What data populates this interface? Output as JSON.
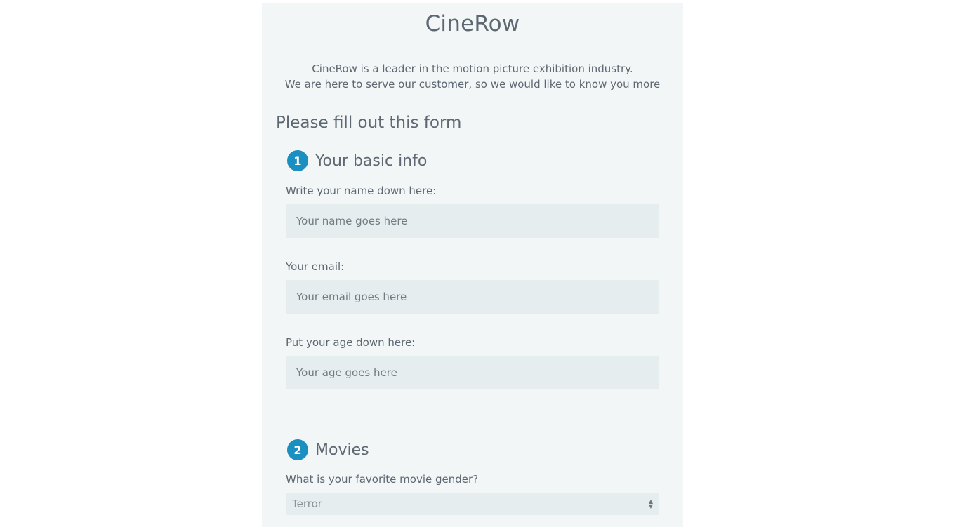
{
  "header": {
    "title": "CineRow",
    "intro_line1": "CineRow is a leader in the motion picture exhibition industry.",
    "intro_line2": "We are here to serve our customer, so we would like to know you more"
  },
  "form": {
    "heading": "Please fill out this form",
    "sections": [
      {
        "number": "1",
        "title": "Your basic info",
        "fields": [
          {
            "label": "Write your name down here:",
            "placeholder": "Your name goes here",
            "value": ""
          },
          {
            "label": "Your email:",
            "placeholder": "Your email goes here",
            "value": ""
          },
          {
            "label": "Put your age down here:",
            "placeholder": "Your age goes here",
            "value": ""
          }
        ]
      },
      {
        "number": "2",
        "title": "Movies",
        "select": {
          "label": "What is your favorite movie gender?",
          "selected": "Terror"
        }
      }
    ]
  },
  "icons": {
    "select_arrows": "up-down-chevron-icon"
  },
  "colors": {
    "panel_bg": "#f2f6f7",
    "input_bg": "#e6edef",
    "badge": "#1b8fc0",
    "text": "#5e6872"
  }
}
